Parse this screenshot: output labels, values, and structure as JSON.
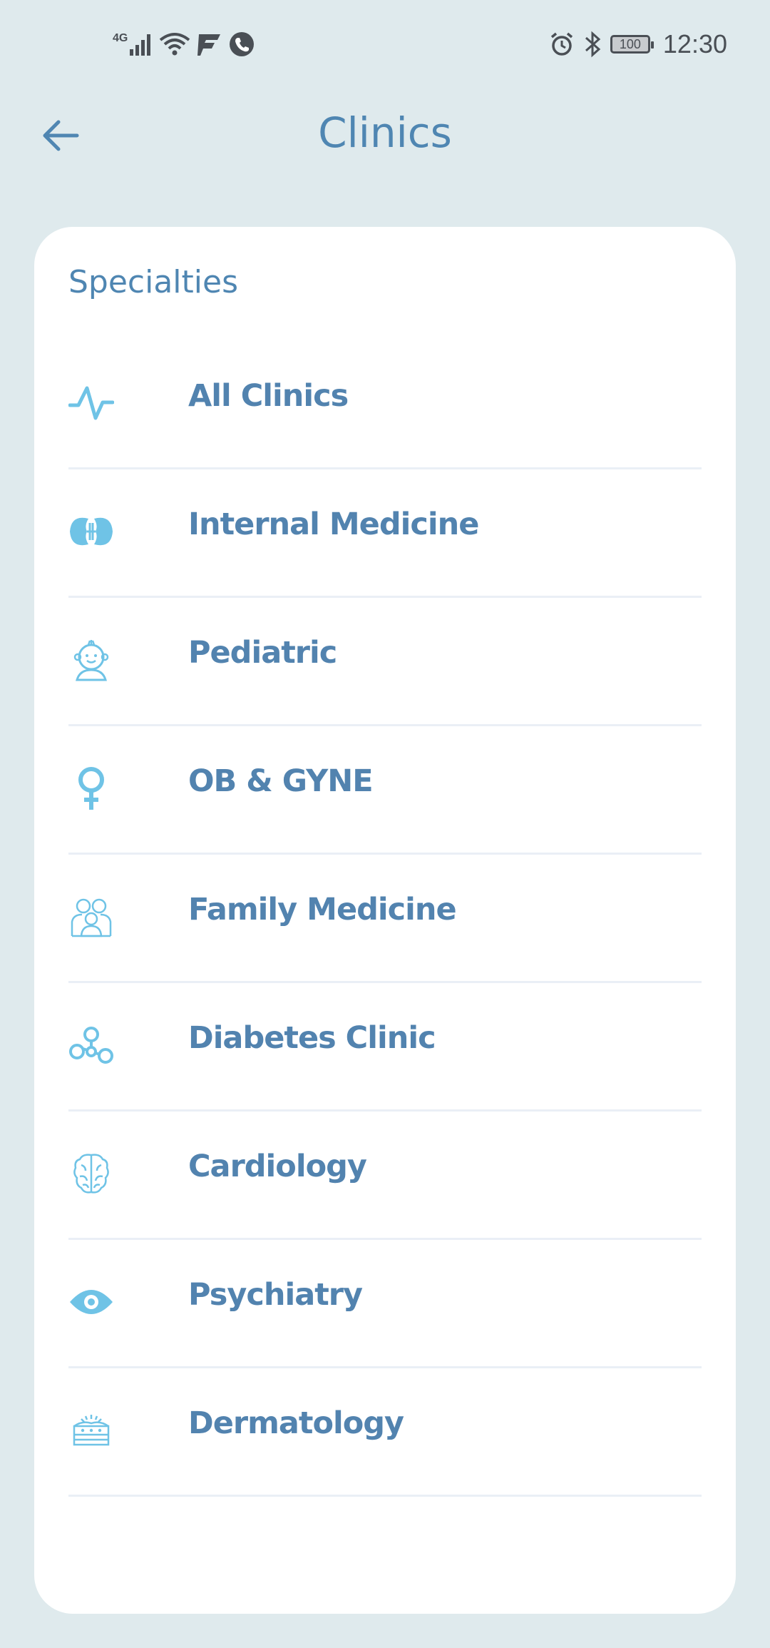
{
  "status_bar": {
    "network_label": "4G",
    "time": "12:30",
    "battery": "100"
  },
  "header": {
    "title": "Clinics"
  },
  "card": {
    "section_title": "Specialties",
    "items": [
      {
        "label": "All Clinics",
        "icon": "activity-pulse-icon"
      },
      {
        "label": "Internal Medicine",
        "icon": "kidneys-icon"
      },
      {
        "label": "Pediatric",
        "icon": "baby-face-icon"
      },
      {
        "label": "OB & GYNE",
        "icon": "female-symbol-icon"
      },
      {
        "label": "Family Medicine",
        "icon": "family-icon"
      },
      {
        "label": "Diabetes Clinic",
        "icon": "molecule-icon"
      },
      {
        "label": "Cardiology",
        "icon": "brain-icon"
      },
      {
        "label": "Psychiatry",
        "icon": "eye-icon"
      },
      {
        "label": "Dermatology",
        "icon": "skin-layers-icon"
      }
    ]
  },
  "colors": {
    "background": "#dfeaed",
    "accent": "#4f86b2",
    "icon": "#6fc3e6",
    "divider": "#eaeff6"
  }
}
